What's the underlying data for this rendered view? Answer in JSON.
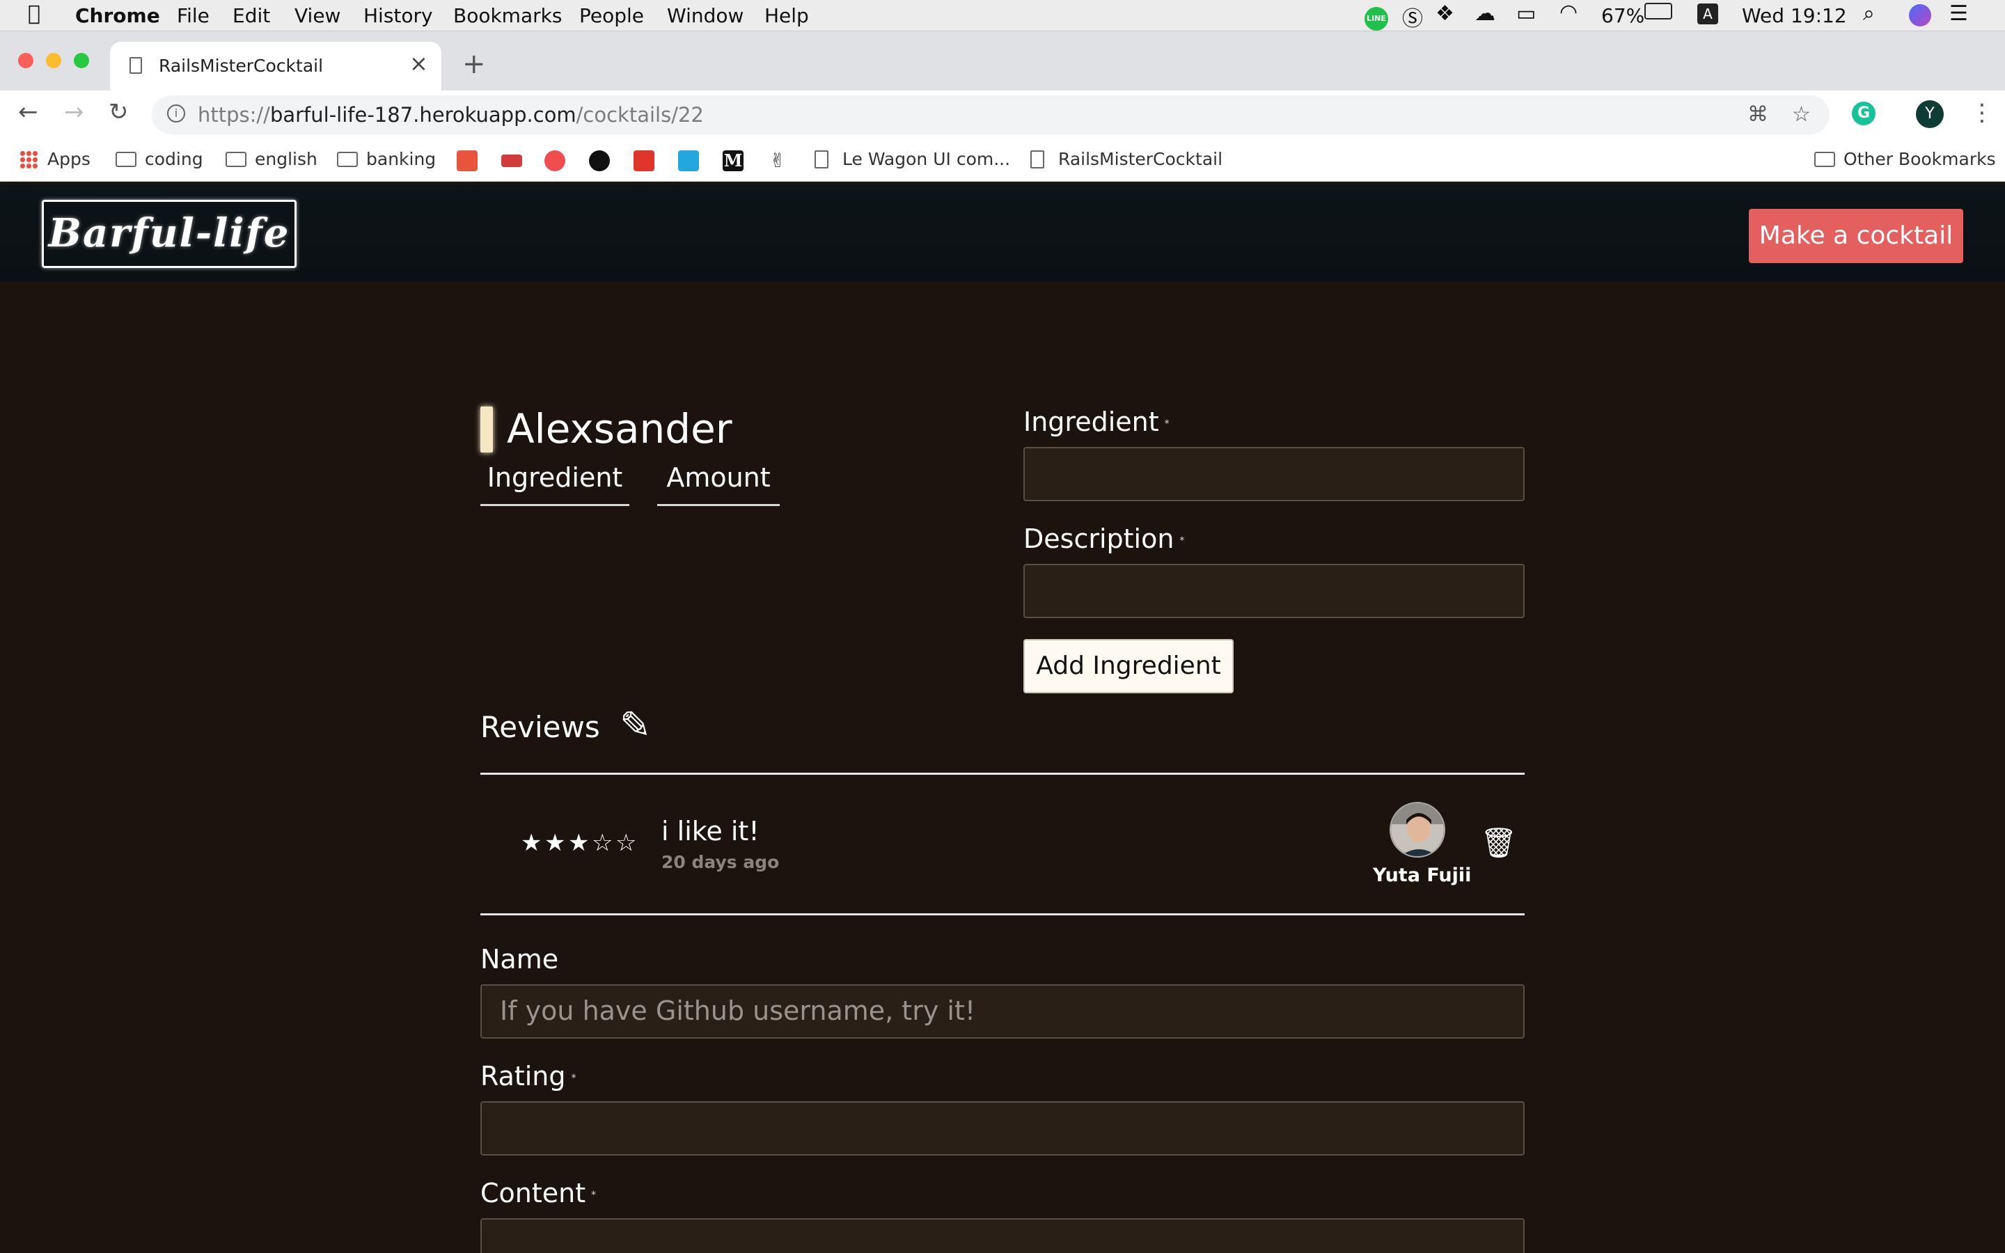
{
  "menubar": {
    "app": "Chrome",
    "items": [
      "File",
      "Edit",
      "View",
      "History",
      "Bookmarks",
      "People",
      "Window",
      "Help"
    ],
    "battery": "67%",
    "input_source": "A",
    "clock": "Wed 19:12",
    "line_label": "LINE"
  },
  "tab": {
    "title": "RailsMisterCocktail",
    "close": "×"
  },
  "new_tab": "+",
  "omnibox": {
    "url_scheme": "https://",
    "url_host": "barful-life-187.herokuapp.com",
    "url_path": "/cocktails/22",
    "profile_initial": "Y",
    "grammarly": "G"
  },
  "bookmarks": {
    "apps": "Apps",
    "folders": [
      "coding",
      "english",
      "banking"
    ],
    "pages": [
      "Le Wagon UI com...",
      "RailsMisterCocktail"
    ],
    "other": "Other Bookmarks",
    "medium": "M"
  },
  "site": {
    "logo": "Barful-life",
    "cta": "Make a cocktail"
  },
  "cocktail": {
    "name": "Alexsander",
    "columns": [
      "Ingredient",
      "Amount"
    ]
  },
  "ingredient_form": {
    "ingredient_label": "Ingredient",
    "description_label": "Description",
    "required_mark": "*",
    "submit": "Add Ingredient"
  },
  "reviews": {
    "heading": "Reviews",
    "items": [
      {
        "rating": 3,
        "max": 5,
        "content": "i like it!",
        "time": "20 days ago",
        "author": "Yuta Fujii"
      }
    ]
  },
  "review_form": {
    "name_label": "Name",
    "name_placeholder": "If you have Github username, try it!",
    "rating_label": "Rating",
    "content_label": "Content",
    "required_mark": "*"
  }
}
